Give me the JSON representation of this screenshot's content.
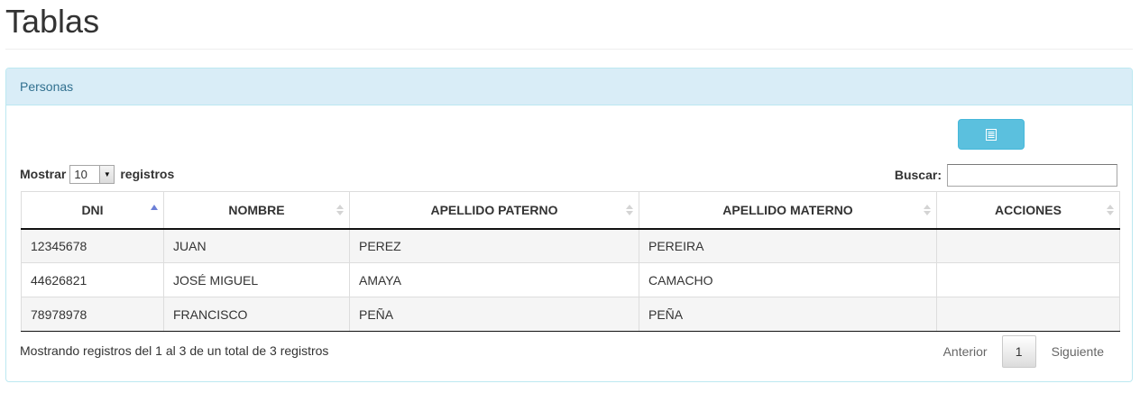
{
  "page": {
    "title": "Tablas"
  },
  "panel": {
    "heading": "Personas",
    "export_button_icon": "table-list-icon",
    "length": {
      "label_before": "Mostrar",
      "selected": "10",
      "label_after": "registros"
    },
    "search": {
      "label": "Buscar:",
      "value": ""
    },
    "table": {
      "columns": [
        "DNI",
        "NOMBRE",
        "APELLIDO PATERNO",
        "APELLIDO MATERNO",
        "ACCIONES"
      ],
      "sorted_column": "DNI",
      "sort_direction": "asc",
      "rows": [
        [
          "12345678",
          "JUAN",
          "PEREZ",
          "PEREIRA",
          ""
        ],
        [
          "44626821",
          "JOSÉ MIGUEL",
          "AMAYA",
          "CAMACHO",
          ""
        ],
        [
          "78978978",
          "FRANCISCO",
          "PEÑA",
          "PEÑA",
          ""
        ]
      ]
    },
    "info": "Mostrando registros del 1 al 3 de un total de 3 registros",
    "pagination": {
      "previous": "Anterior",
      "current_page": "1",
      "next": "Siguiente"
    }
  },
  "colors": {
    "panel_heading_bg": "#d9edf7",
    "panel_heading_text": "#31708f",
    "info_button": "#5bc0de"
  }
}
